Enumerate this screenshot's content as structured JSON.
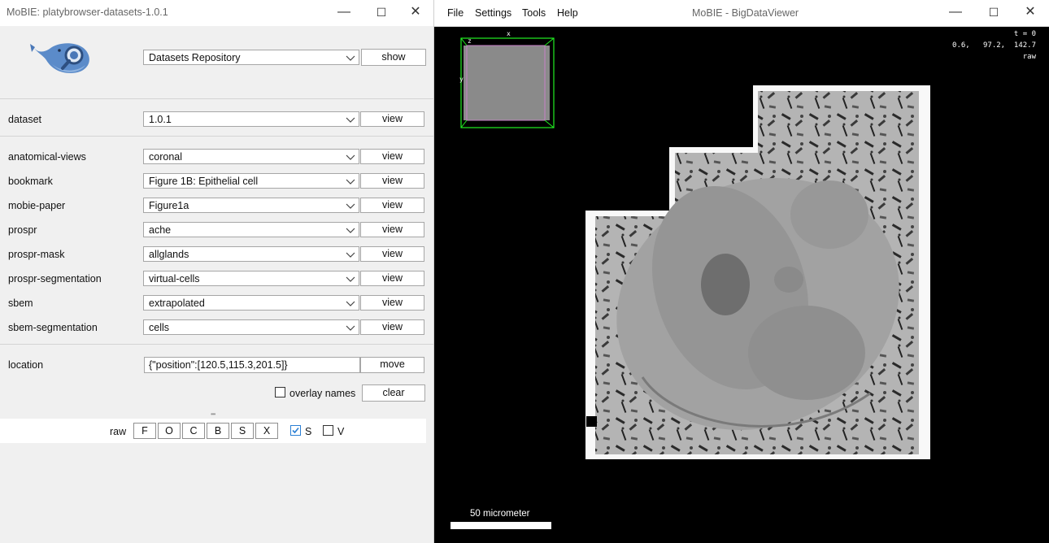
{
  "left_window": {
    "title": "MoBIE: platybrowser-datasets-1.0.1",
    "controls": {
      "minimize": "—",
      "maximize": "☐",
      "close": "✕"
    },
    "repository": {
      "selected": "Datasets Repository",
      "button": "show"
    },
    "dataset": {
      "label": "dataset",
      "selected": "1.0.1",
      "button": "view"
    },
    "sources": [
      {
        "label": "anatomical-views",
        "selected": "coronal",
        "button": "view"
      },
      {
        "label": "bookmark",
        "selected": "Figure 1B: Epithelial cell",
        "button": "view"
      },
      {
        "label": "mobie-paper",
        "selected": "Figure1a",
        "button": "view"
      },
      {
        "label": "prospr",
        "selected": "ache",
        "button": "view"
      },
      {
        "label": "prospr-mask",
        "selected": "allglands",
        "button": "view"
      },
      {
        "label": "prospr-segmentation",
        "selected": "virtual-cells",
        "button": "view"
      },
      {
        "label": "sbem",
        "selected": "extrapolated",
        "button": "view"
      },
      {
        "label": "sbem-segmentation",
        "selected": "cells",
        "button": "view"
      }
    ],
    "location": {
      "label": "location",
      "value": "{\"position\":[120.5,115.3,201.5]}",
      "button": "move"
    },
    "overlay_names": {
      "label": "overlay names",
      "checked": false
    },
    "clear_button": "clear",
    "divider_dots": "•••",
    "layer_row": {
      "name": "raw",
      "toggles": [
        "F",
        "O",
        "C",
        "B",
        "S",
        "X"
      ],
      "checks": [
        {
          "label": "S",
          "checked": true
        },
        {
          "label": "V",
          "checked": false
        }
      ]
    }
  },
  "right_window": {
    "title": "MoBIE - BigDataViewer",
    "menu": [
      "File",
      "Settings",
      "Tools",
      "Help"
    ],
    "controls": {
      "minimize": "—",
      "maximize": "☐",
      "close": "✕"
    },
    "overlay": {
      "time": "t = 0",
      "coords": "0.6,   97.2,  142.7",
      "source_name": "raw",
      "axis_x": "x",
      "axis_y": "y",
      "axis_z": "z"
    },
    "scalebar_label": "50 micrometer"
  },
  "colors": {
    "accent": "#2a7fd4",
    "nav_box": "#22ee22",
    "tissue": "#9a9a9a"
  }
}
